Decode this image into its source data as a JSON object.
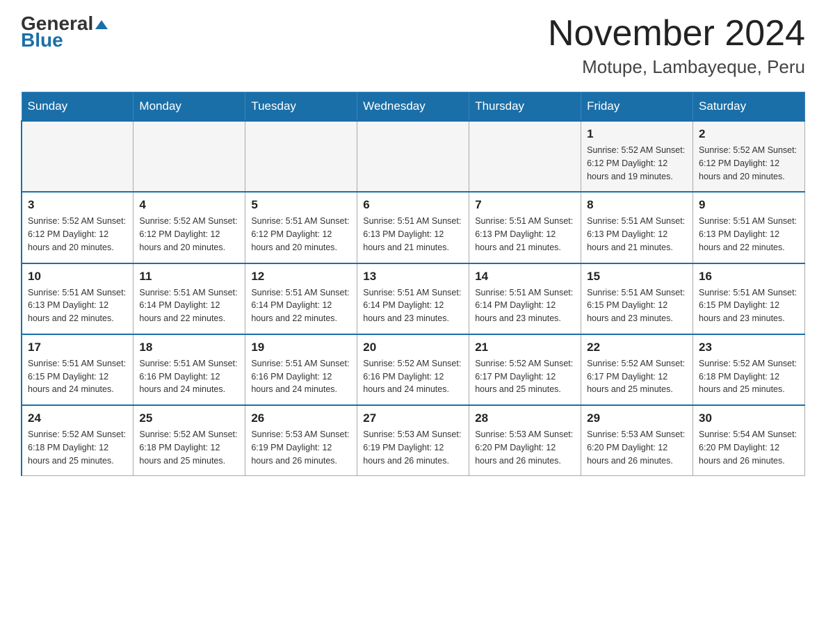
{
  "header": {
    "logo_general": "General",
    "logo_blue": "Blue",
    "month_title": "November 2024",
    "location": "Motupe, Lambayeque, Peru"
  },
  "days_of_week": [
    "Sunday",
    "Monday",
    "Tuesday",
    "Wednesday",
    "Thursday",
    "Friday",
    "Saturday"
  ],
  "weeks": [
    {
      "days": [
        {
          "number": "",
          "info": ""
        },
        {
          "number": "",
          "info": ""
        },
        {
          "number": "",
          "info": ""
        },
        {
          "number": "",
          "info": ""
        },
        {
          "number": "",
          "info": ""
        },
        {
          "number": "1",
          "info": "Sunrise: 5:52 AM\nSunset: 6:12 PM\nDaylight: 12 hours\nand 19 minutes."
        },
        {
          "number": "2",
          "info": "Sunrise: 5:52 AM\nSunset: 6:12 PM\nDaylight: 12 hours\nand 20 minutes."
        }
      ]
    },
    {
      "days": [
        {
          "number": "3",
          "info": "Sunrise: 5:52 AM\nSunset: 6:12 PM\nDaylight: 12 hours\nand 20 minutes."
        },
        {
          "number": "4",
          "info": "Sunrise: 5:52 AM\nSunset: 6:12 PM\nDaylight: 12 hours\nand 20 minutes."
        },
        {
          "number": "5",
          "info": "Sunrise: 5:51 AM\nSunset: 6:12 PM\nDaylight: 12 hours\nand 20 minutes."
        },
        {
          "number": "6",
          "info": "Sunrise: 5:51 AM\nSunset: 6:13 PM\nDaylight: 12 hours\nand 21 minutes."
        },
        {
          "number": "7",
          "info": "Sunrise: 5:51 AM\nSunset: 6:13 PM\nDaylight: 12 hours\nand 21 minutes."
        },
        {
          "number": "8",
          "info": "Sunrise: 5:51 AM\nSunset: 6:13 PM\nDaylight: 12 hours\nand 21 minutes."
        },
        {
          "number": "9",
          "info": "Sunrise: 5:51 AM\nSunset: 6:13 PM\nDaylight: 12 hours\nand 22 minutes."
        }
      ]
    },
    {
      "days": [
        {
          "number": "10",
          "info": "Sunrise: 5:51 AM\nSunset: 6:13 PM\nDaylight: 12 hours\nand 22 minutes."
        },
        {
          "number": "11",
          "info": "Sunrise: 5:51 AM\nSunset: 6:14 PM\nDaylight: 12 hours\nand 22 minutes."
        },
        {
          "number": "12",
          "info": "Sunrise: 5:51 AM\nSunset: 6:14 PM\nDaylight: 12 hours\nand 22 minutes."
        },
        {
          "number": "13",
          "info": "Sunrise: 5:51 AM\nSunset: 6:14 PM\nDaylight: 12 hours\nand 23 minutes."
        },
        {
          "number": "14",
          "info": "Sunrise: 5:51 AM\nSunset: 6:14 PM\nDaylight: 12 hours\nand 23 minutes."
        },
        {
          "number": "15",
          "info": "Sunrise: 5:51 AM\nSunset: 6:15 PM\nDaylight: 12 hours\nand 23 minutes."
        },
        {
          "number": "16",
          "info": "Sunrise: 5:51 AM\nSunset: 6:15 PM\nDaylight: 12 hours\nand 23 minutes."
        }
      ]
    },
    {
      "days": [
        {
          "number": "17",
          "info": "Sunrise: 5:51 AM\nSunset: 6:15 PM\nDaylight: 12 hours\nand 24 minutes."
        },
        {
          "number": "18",
          "info": "Sunrise: 5:51 AM\nSunset: 6:16 PM\nDaylight: 12 hours\nand 24 minutes."
        },
        {
          "number": "19",
          "info": "Sunrise: 5:51 AM\nSunset: 6:16 PM\nDaylight: 12 hours\nand 24 minutes."
        },
        {
          "number": "20",
          "info": "Sunrise: 5:52 AM\nSunset: 6:16 PM\nDaylight: 12 hours\nand 24 minutes."
        },
        {
          "number": "21",
          "info": "Sunrise: 5:52 AM\nSunset: 6:17 PM\nDaylight: 12 hours\nand 25 minutes."
        },
        {
          "number": "22",
          "info": "Sunrise: 5:52 AM\nSunset: 6:17 PM\nDaylight: 12 hours\nand 25 minutes."
        },
        {
          "number": "23",
          "info": "Sunrise: 5:52 AM\nSunset: 6:18 PM\nDaylight: 12 hours\nand 25 minutes."
        }
      ]
    },
    {
      "days": [
        {
          "number": "24",
          "info": "Sunrise: 5:52 AM\nSunset: 6:18 PM\nDaylight: 12 hours\nand 25 minutes."
        },
        {
          "number": "25",
          "info": "Sunrise: 5:52 AM\nSunset: 6:18 PM\nDaylight: 12 hours\nand 25 minutes."
        },
        {
          "number": "26",
          "info": "Sunrise: 5:53 AM\nSunset: 6:19 PM\nDaylight: 12 hours\nand 26 minutes."
        },
        {
          "number": "27",
          "info": "Sunrise: 5:53 AM\nSunset: 6:19 PM\nDaylight: 12 hours\nand 26 minutes."
        },
        {
          "number": "28",
          "info": "Sunrise: 5:53 AM\nSunset: 6:20 PM\nDaylight: 12 hours\nand 26 minutes."
        },
        {
          "number": "29",
          "info": "Sunrise: 5:53 AM\nSunset: 6:20 PM\nDaylight: 12 hours\nand 26 minutes."
        },
        {
          "number": "30",
          "info": "Sunrise: 5:54 AM\nSunset: 6:20 PM\nDaylight: 12 hours\nand 26 minutes."
        }
      ]
    }
  ]
}
